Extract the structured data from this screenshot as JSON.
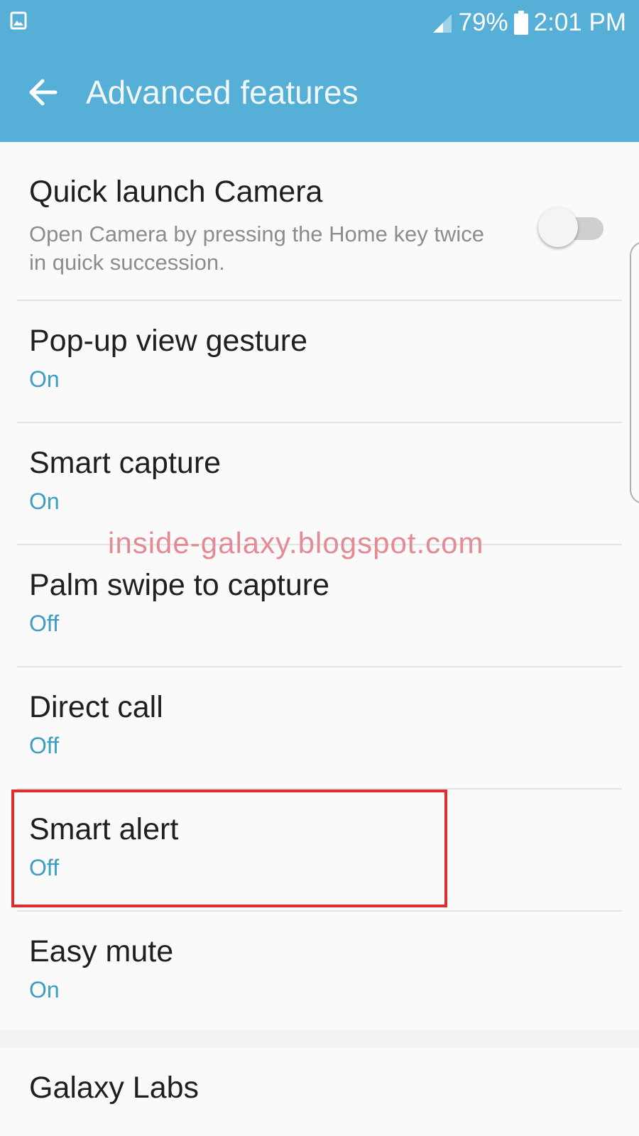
{
  "status_bar": {
    "battery_percent": "79%",
    "time": "2:01 PM"
  },
  "toolbar": {
    "title": "Advanced features"
  },
  "colors": {
    "app_bar": "#55afd6",
    "accent_text": "#3d9dc2",
    "highlight": "#df2c2c",
    "watermark": "#e48a92"
  },
  "settings": {
    "quick_launch_camera": {
      "title": "Quick launch Camera",
      "description": "Open Camera by pressing the Home key twice in quick succession.",
      "enabled": false
    },
    "popup_view_gesture": {
      "title": "Pop-up view gesture",
      "status": "On"
    },
    "smart_capture": {
      "title": "Smart capture",
      "status": "On"
    },
    "palm_swipe": {
      "title": "Palm swipe to capture",
      "status": "Off"
    },
    "direct_call": {
      "title": "Direct call",
      "status": "Off"
    },
    "smart_alert": {
      "title": "Smart alert",
      "status": "Off"
    },
    "easy_mute": {
      "title": "Easy mute",
      "status": "On"
    }
  },
  "galaxy_labs": {
    "title": "Galaxy Labs"
  },
  "watermark": {
    "text": "inside-galaxy.blogspot.com"
  }
}
